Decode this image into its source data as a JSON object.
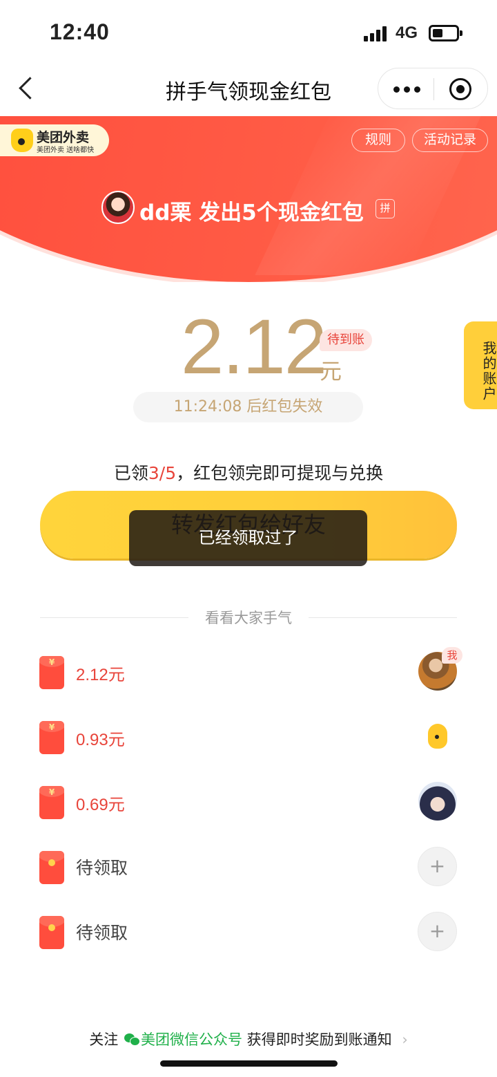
{
  "status": {
    "time": "12:40",
    "network": "4G"
  },
  "nav": {
    "title": "拼手气领现金红包"
  },
  "banner": {
    "logo_name": "美团外卖",
    "logo_slogan": "美团外卖 送啥都快",
    "rules_label": "规则",
    "records_label": "活动记录",
    "sender_text": "dd栗 发出5个现金红包",
    "pin_badge": "拼"
  },
  "amount": {
    "value": "2.12",
    "unit": "元",
    "status_tag": "待到账"
  },
  "timer": {
    "countdown": "11:24:08",
    "suffix": "后红包失效"
  },
  "progress": {
    "prefix": "已领",
    "claimed": "3/5",
    "suffix": "，红包领完即可提现与兑换"
  },
  "forward_button": {
    "label": "转发红包给好友"
  },
  "toast": {
    "message": "已经领取过了"
  },
  "account_tab": {
    "label": "我的账户"
  },
  "luck_section": {
    "title": "看看大家手气"
  },
  "claims": [
    {
      "amount": "2.12元",
      "me_tag": "我"
    },
    {
      "amount": "0.93元"
    },
    {
      "amount": "0.69元"
    }
  ],
  "pending": [
    {
      "label": "待领取",
      "add": "+"
    },
    {
      "label": "待领取",
      "add": "+"
    }
  ],
  "envelope_symbol": "¥",
  "footer": {
    "prefix": "关注",
    "link": "美团微信公众号",
    "suffix": "获得即时奖励到账通知",
    "chevron": "›"
  },
  "colors": {
    "brand_red": "#ff4a3a",
    "gold": "#c6a574",
    "yellow_button": "#ffcf3a",
    "wechat_green": "#20b04a"
  }
}
